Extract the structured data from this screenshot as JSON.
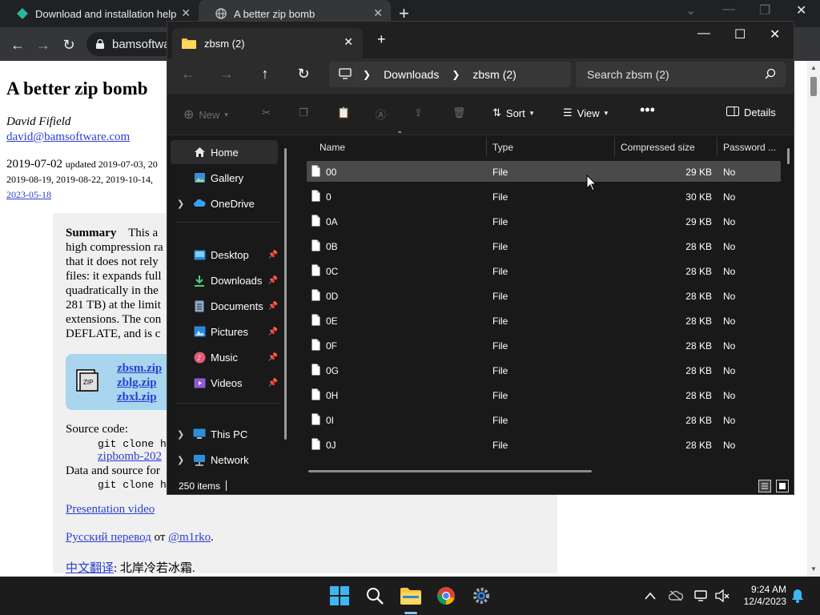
{
  "chrome": {
    "tabs": [
      {
        "title": "Download and installation help"
      },
      {
        "title": "A better zip bomb"
      }
    ],
    "address": "bamsoftwa"
  },
  "webpage": {
    "title": "A better zip bomb",
    "author": "David Fifield",
    "email": "david@bamsoftware.com",
    "date_line1_main": "2019-07-02",
    "date_line1_small": "updated 2019-07-03, 20",
    "date_line2": "2019-08-19, 2019-08-22, 2019-10-14,",
    "date_line3": "2023-05-18",
    "summary_label": "Summary",
    "summary_lines": [
      "This a",
      "high compression ra",
      "that it does not rely",
      "files: it expands full",
      "quadratically in the",
      "281 TB) at the limit",
      "extensions. The con",
      "DEFLATE, and is c"
    ],
    "zip_links": [
      "zbsm.zip",
      "zblg.zip",
      "zbxl.zip"
    ],
    "source_code_label": "Source code:",
    "source_code_cmd": "git clone ht",
    "source_code_link": "zipbomb-202",
    "data_source_label": "Data and source for",
    "data_source_cmd": "git clone ht",
    "presentation_link": "Presentation video",
    "russian_link": "Русский перевод",
    "russian_from": "от",
    "russian_author": "@m1rko",
    "russian_end": ".",
    "chinese_link": "中文翻译",
    "chinese_rest": ": 北岸冷若冰霜."
  },
  "explorer": {
    "tab_title": "zbsm (2)",
    "breadcrumb": [
      "Downloads",
      "zbsm (2)"
    ],
    "search_placeholder": "Search zbsm (2)",
    "commands": {
      "new": "New",
      "sort": "Sort",
      "view": "View",
      "details": "Details"
    },
    "nav": {
      "home": "Home",
      "gallery": "Gallery",
      "onedrive": "OneDrive",
      "desktop": "Desktop",
      "downloads": "Downloads",
      "documents": "Documents",
      "pictures": "Pictures",
      "music": "Music",
      "videos": "Videos",
      "thispc": "This PC",
      "network": "Network"
    },
    "columns": {
      "name": "Name",
      "type": "Type",
      "size": "Compressed size",
      "password": "Password ..."
    },
    "files": [
      {
        "name": "00",
        "type": "File",
        "size": "29 KB",
        "password": "No"
      },
      {
        "name": "0",
        "type": "File",
        "size": "30 KB",
        "password": "No"
      },
      {
        "name": "0A",
        "type": "File",
        "size": "29 KB",
        "password": "No"
      },
      {
        "name": "0B",
        "type": "File",
        "size": "28 KB",
        "password": "No"
      },
      {
        "name": "0C",
        "type": "File",
        "size": "28 KB",
        "password": "No"
      },
      {
        "name": "0D",
        "type": "File",
        "size": "28 KB",
        "password": "No"
      },
      {
        "name": "0E",
        "type": "File",
        "size": "28 KB",
        "password": "No"
      },
      {
        "name": "0F",
        "type": "File",
        "size": "28 KB",
        "password": "No"
      },
      {
        "name": "0G",
        "type": "File",
        "size": "28 KB",
        "password": "No"
      },
      {
        "name": "0H",
        "type": "File",
        "size": "28 KB",
        "password": "No"
      },
      {
        "name": "0I",
        "type": "File",
        "size": "28 KB",
        "password": "No"
      },
      {
        "name": "0J",
        "type": "File",
        "size": "28 KB",
        "password": "No"
      }
    ],
    "status": "250 items"
  },
  "taskbar": {
    "time": "9:24 AM",
    "date": "12/4/2023"
  },
  "colors": {
    "accent": "#0078d4",
    "link": "#2b3fd3",
    "zipbox": "#a9d6ee"
  }
}
